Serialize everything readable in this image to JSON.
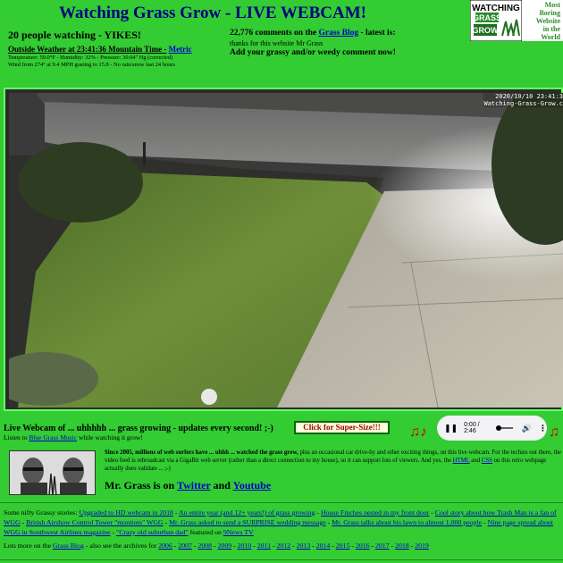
{
  "header": {
    "title": "Watching Grass Grow - LIVE WEBCAM!",
    "logo_text": [
      "WATCHING",
      "GRASS",
      "GROW"
    ],
    "logo_tagline": [
      "Most",
      "Boring",
      "Website",
      "in the",
      "World"
    ]
  },
  "watchers": {
    "text": "20 people watching - YIKES!"
  },
  "weather": {
    "title": "Outside Weather at 23:41:36 Mountain Time -",
    "metric_link": "Metric",
    "line1": "Temperature: 59.0°F - Humidity: 32% - Pressure: 30.04\" Hg (corrected)",
    "line2": "Wind from 274° at 9.4 MPH gusting to 15.8 - No rain/snow last 24 hours"
  },
  "comments": {
    "count_text": "22,776 comments on the",
    "blog_link": "Grass Blog",
    "latest_text": "- latest is:",
    "latest_comment": "thanks for this website Mr Grass",
    "add_text": "Add your grassy and/or weedy comment now!"
  },
  "webcam": {
    "timestamp": "2020/10/10 23:41:3",
    "watermark": "Watching-Grass-Grow.c"
  },
  "live": {
    "title": "Live Webcam of ... uhhhhh ... grass growing - updates every second! ;-)",
    "listen_prefix": "Listen to",
    "listen_link": "Blue Grass Music",
    "listen_suffix": "while watching it grow!",
    "supersize_label": "Click for Super-Size!!!"
  },
  "player": {
    "time": "0:00 / 2:46",
    "play_icon": "pause-icon",
    "volume_icon": "volume-icon",
    "menu_icon": "more-vert-icon"
  },
  "about": {
    "since_bold": "Since 2005, millions of web surfers have ... uhhh ... watched the grass grow,",
    "since_rest": "plus an occasional car drive-by and other exciting things, on this live webcam. For the techies out there, the video feed is rebroadcast via a GigaBit web server (rather than a direct connection to my house), so it can support lots of viewers. And yes, the",
    "html_link": "HTML",
    "and": "and",
    "css_link": "CSS",
    "since_end": "on this retro webpage actually does validate ... ;-)",
    "follow_prefix": "Mr. Grass is on",
    "twitter_link": "Twitter",
    "follow_and": "and",
    "youtube_link": "Youtube"
  },
  "stories": {
    "prefix": "Some nifty Grassy stories:",
    "items": [
      "Upgraded to HD webcam in 2018",
      "An entire year (and 12+ years!) of grass growing",
      "House Finches nested in my front door",
      "Cool story about how Trash Man is a fan of WGG",
      "British Airshow Control Tower \"monitors\" WGG",
      "Mr. Grass asked to send a SURPRISE wedding message",
      "Mr. Grass talks about his lawn to almost 1,000 people",
      "Nine page spread about WGG in Southwest Airlines magazine",
      "\"Crazy old suburban dad\""
    ],
    "featured_suffix": "featured on",
    "news_link": "9News TV"
  },
  "archives": {
    "prefix": "Lots more on the",
    "blog_link": "Grass Blog",
    "middle": "- also see the archives for",
    "years": [
      "2006",
      "2007",
      "2008",
      "2009",
      "2010",
      "2011",
      "2012",
      "2013",
      "2014",
      "2015",
      "2016",
      "2017",
      "2018",
      "2019"
    ]
  },
  "colors": {
    "background": "#33cc33",
    "title": "#000080",
    "link": "#0000cc",
    "frame": "#66ff66"
  }
}
